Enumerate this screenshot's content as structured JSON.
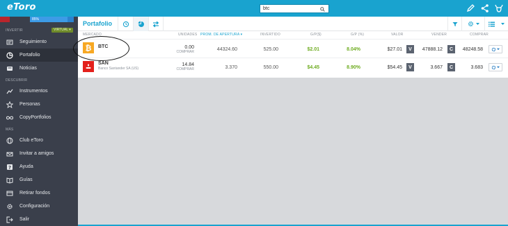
{
  "app": {
    "logo": "eToro"
  },
  "search": {
    "value": "btc"
  },
  "sidebar": {
    "progress_text": "85%",
    "progress_fraction": 0.85,
    "invest_section": "INVERTIR",
    "virtual_badge": "VIRTUAL ▾",
    "discover_section": "DESCUBRIR",
    "more_section": "MÁS",
    "items": [
      {
        "label": "Seguimiento",
        "icon": "newspaper-icon"
      },
      {
        "label": "Portafolio",
        "icon": "pie-chart-icon"
      },
      {
        "label": "Noticias",
        "icon": "news-icon"
      },
      {
        "label": "Instrumentos",
        "icon": "trend-icon"
      },
      {
        "label": "Personas",
        "icon": "star-icon"
      },
      {
        "label": "CopyPortfolios",
        "icon": "infinity-icon"
      },
      {
        "label": "Club eToro",
        "icon": "globe-icon"
      },
      {
        "label": "Invitar a amigos",
        "icon": "invite-icon"
      },
      {
        "label": "Ayuda",
        "icon": "help-icon"
      },
      {
        "label": "Guías",
        "icon": "book-icon"
      },
      {
        "label": "Retirar fondos",
        "icon": "wallet-icon"
      },
      {
        "label": "Configuración",
        "icon": "gear-icon"
      },
      {
        "label": "Salir",
        "icon": "logout-icon"
      }
    ]
  },
  "portfolio": {
    "title": "Portafolio",
    "columns": {
      "market": "MERCADO",
      "units": "UNIDADES",
      "open": "PROM. DE APERTURA ▾",
      "invested": "INVERTIDO",
      "pl": "G/P($)",
      "pl_pct": "G/P (%)",
      "value": "VALOR",
      "sell": "VENDER",
      "buy": "COMPRAR"
    },
    "rows": [
      {
        "symbol": "BTC",
        "full_name": "",
        "units": "0.00",
        "units_sub": "COMPRAR",
        "open": "44324.60",
        "invested": "525.00",
        "pl": "$2.01",
        "pl_pct": "8.04%",
        "value": "$27.01",
        "sell": "47888.12",
        "buy": "48248.58",
        "logo_color": "#f7a823"
      },
      {
        "symbol": "SAN",
        "full_name": "Banco Santander SA (US)",
        "units": "14.84",
        "units_sub": "COMPRAR",
        "open": "3.370",
        "invested": "550.00",
        "pl": "$4.45",
        "pl_pct": "8.90%",
        "value": "$54.45",
        "sell": "3.667",
        "buy": "3.683",
        "logo_color": "#e3201b"
      }
    ],
    "sell_badge": "V",
    "buy_badge": "C"
  },
  "colors": {
    "brand": "#19a3cf",
    "positive": "#6eac20",
    "sidebar": "#3a3f4b"
  }
}
